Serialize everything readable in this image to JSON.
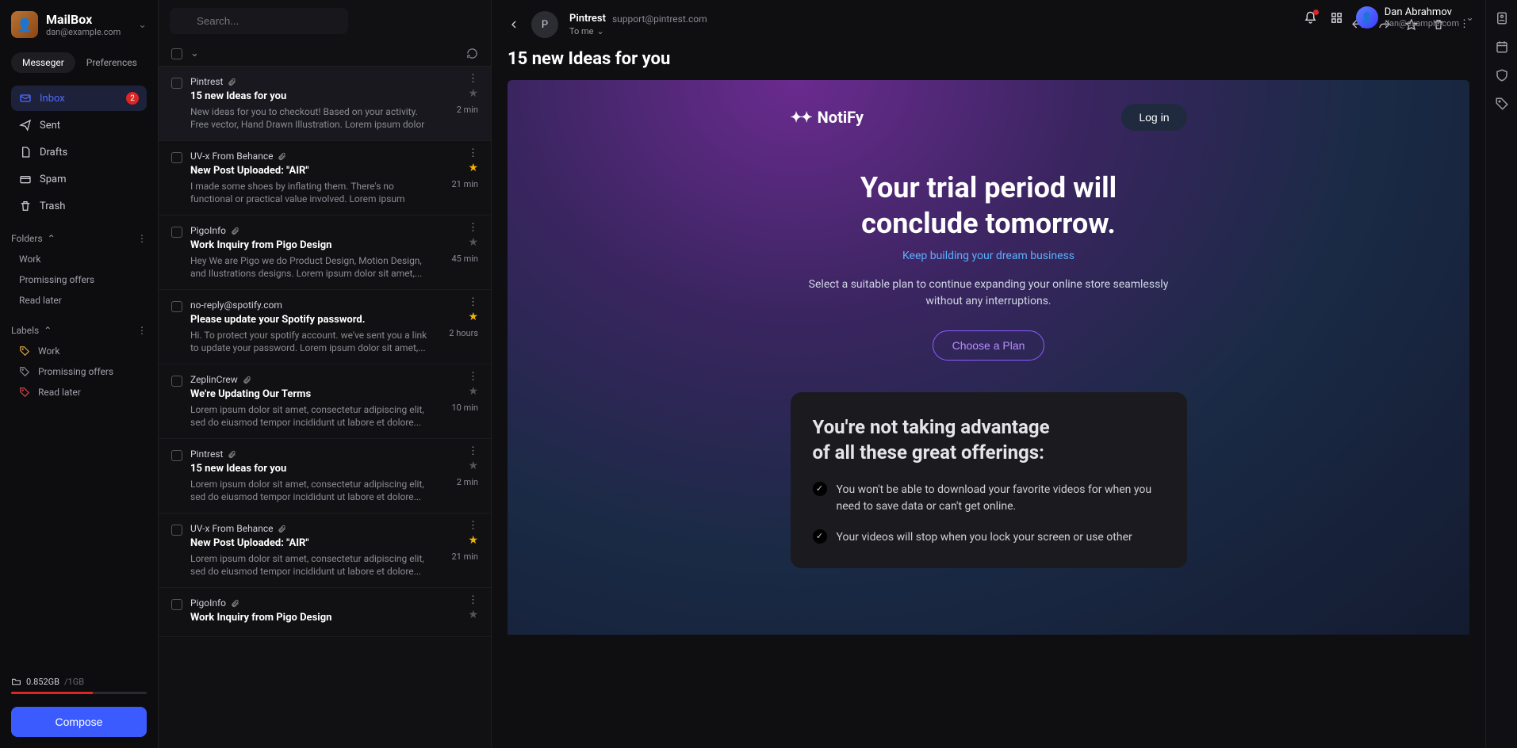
{
  "brand": {
    "title": "MailBox",
    "subtitle": "dan@example.com"
  },
  "tabs": {
    "messenger": "Messeger",
    "preferences": "Preferences"
  },
  "nav": {
    "inbox": {
      "label": "Inbox",
      "badge": "2"
    },
    "sent": "Sent",
    "drafts": "Drafts",
    "spam": "Spam",
    "trash": "Trash"
  },
  "folders": {
    "header": "Folders",
    "items": [
      "Work",
      "Promissing offers",
      "Read later"
    ]
  },
  "labels": {
    "header": "Labels",
    "items": [
      {
        "name": "Work",
        "color": "#d9a441"
      },
      {
        "name": "Promissing offers",
        "color": "#8a8a92"
      },
      {
        "name": "Read later",
        "color": "#d14a4a"
      }
    ]
  },
  "storage": {
    "used": "0.852GB",
    "sep": "/",
    "total": "1GB",
    "percent": 60
  },
  "compose": "Compose",
  "search": {
    "placeholder": "Search..."
  },
  "user": {
    "name": "Dan Abrahmov",
    "email": "dan@example.com"
  },
  "messages": [
    {
      "from": "Pintrest",
      "subject": "15 new Ideas for you",
      "preview": "New ideas for you to checkout! Based on your activity. Free vector, Hand Drawn Illustration. Lorem ipsum dolor sit...",
      "time": "2 min",
      "attach": true,
      "star": false,
      "selected": true
    },
    {
      "from": "UV-x From Behance",
      "subject": "New Post Uploaded: \"AIR\"",
      "preview": "I made some shoes by inflating them. There's no functional or practical value involved. Lorem ipsum dolor...",
      "time": "21 min",
      "attach": true,
      "star": true
    },
    {
      "from": "PigoInfo",
      "subject": "Work Inquiry from Pigo Design",
      "preview": "Hey We are Pigo we do Product Design, Motion Design, and Ilustrations designs. Lorem ipsum dolor sit amet,...",
      "time": "45 min",
      "attach": true,
      "star": false
    },
    {
      "from": "no-reply@spotify.com",
      "subject": "Please update your Spotify password.",
      "preview": "Hi. To protect your spotify account. we've sent you a link to update your password. Lorem ipsum dolor sit amet,...",
      "time": "2 hours",
      "attach": false,
      "star": true
    },
    {
      "from": "ZeplinCrew",
      "subject": "We're Updating Our Terms",
      "preview": "Lorem ipsum dolor sit amet, consectetur adipiscing elit, sed do eiusmod tempor incididunt ut labore et dolore...",
      "time": "10 min",
      "attach": true,
      "star": false
    },
    {
      "from": "Pintrest",
      "subject": "15 new Ideas for you",
      "preview": "Lorem ipsum dolor sit amet, consectetur adipiscing elit, sed do eiusmod tempor incididunt ut labore et dolore...",
      "time": "2 min",
      "attach": true,
      "star": false
    },
    {
      "from": "UV-x From Behance",
      "subject": "New Post Uploaded: \"AIR\"",
      "preview": "Lorem ipsum dolor sit amet, consectetur adipiscing elit, sed do eiusmod tempor incididunt ut labore et dolore...",
      "time": "21 min",
      "attach": true,
      "star": true
    },
    {
      "from": "PigoInfo",
      "subject": "Work Inquiry from Pigo Design",
      "preview": "",
      "time": "",
      "attach": true,
      "star": false
    }
  ],
  "reader": {
    "avatar_letter": "P",
    "from_name": "Pintrest",
    "from_email": "support@pintrest.com",
    "to": "To me",
    "subject": "15 new Ideas for you"
  },
  "email_content": {
    "logo": "NotiFy",
    "login": "Log in",
    "headline1": "Your trial period will",
    "headline2": "conclude tomorrow.",
    "sublink": "Keep building your dream business",
    "subtext": "Select a suitable plan to continue expanding your online store seamlessly without any interruptions.",
    "plan_cta": "Choose a Plan",
    "card_title1": "You're not taking advantage",
    "card_title2": "of all these great offerings:",
    "bullets": [
      "You won't be able to download your favorite videos for when you need to save data or can't get online.",
      "Your videos will stop when you lock your screen or use other"
    ]
  }
}
